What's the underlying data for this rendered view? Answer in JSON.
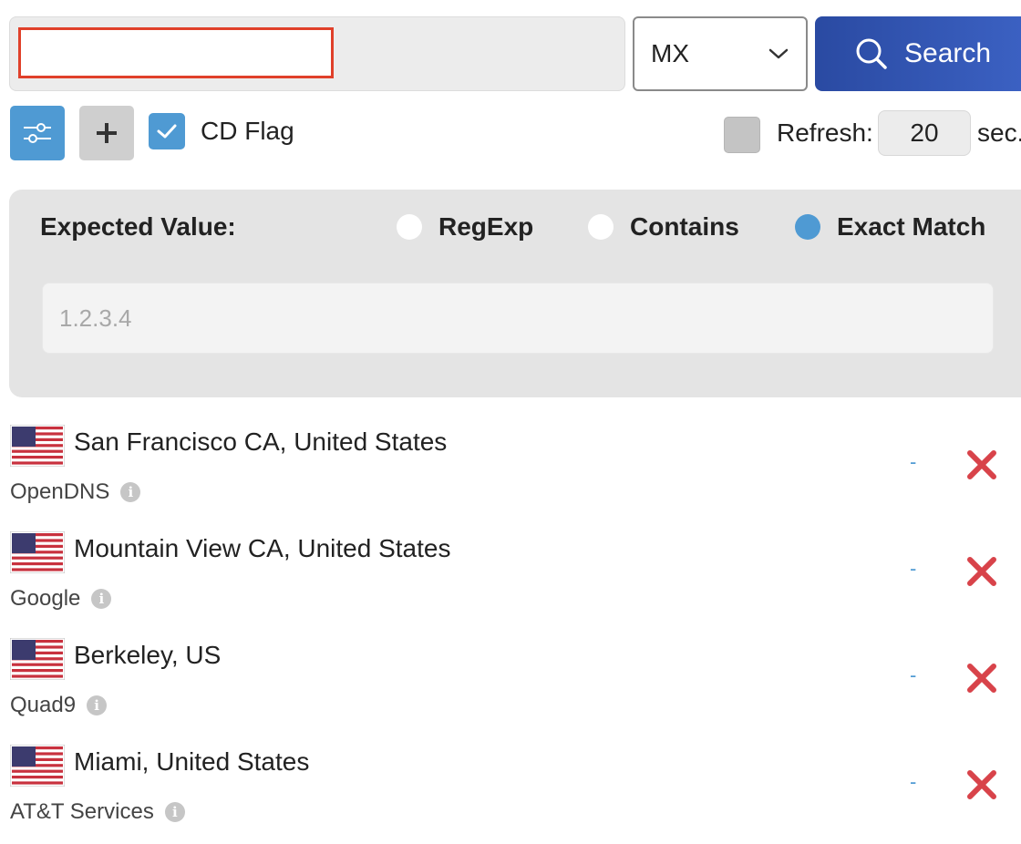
{
  "query": {
    "domain_value": "",
    "record_type": "MX",
    "search_label": "Search"
  },
  "options": {
    "cd_flag_label": "CD Flag",
    "cd_flag_checked": true,
    "refresh_label": "Refresh:",
    "refresh_value": "20",
    "refresh_unit": "sec.",
    "refresh_checked": false
  },
  "expected": {
    "label": "Expected Value:",
    "modes": [
      {
        "label": "RegExp",
        "selected": false
      },
      {
        "label": "Contains",
        "selected": false
      },
      {
        "label": "Exact Match",
        "selected": true
      }
    ],
    "placeholder": "1.2.3.4"
  },
  "resolvers": [
    {
      "location": "San Francisco CA, United States",
      "provider": "OpenDNS",
      "result": "-"
    },
    {
      "location": "Mountain View CA, United States",
      "provider": "Google",
      "result": "-"
    },
    {
      "location": "Berkeley, US",
      "provider": "Quad9",
      "result": "-"
    },
    {
      "location": "Miami, United States",
      "provider": "AT&T Services",
      "result": "-"
    }
  ],
  "colors": {
    "accent": "#4f9ad3",
    "search_button": "#2a4aa2",
    "delete": "#d8434a",
    "input_highlight": "#e0402a"
  },
  "icons": {
    "search": "search-icon",
    "filter": "sliders-icon",
    "add": "plus-icon",
    "check": "checkmark-icon",
    "dropdown": "chevron-down-icon",
    "info": "info-icon",
    "delete": "close-x-icon",
    "flag": "us-flag-icon"
  }
}
